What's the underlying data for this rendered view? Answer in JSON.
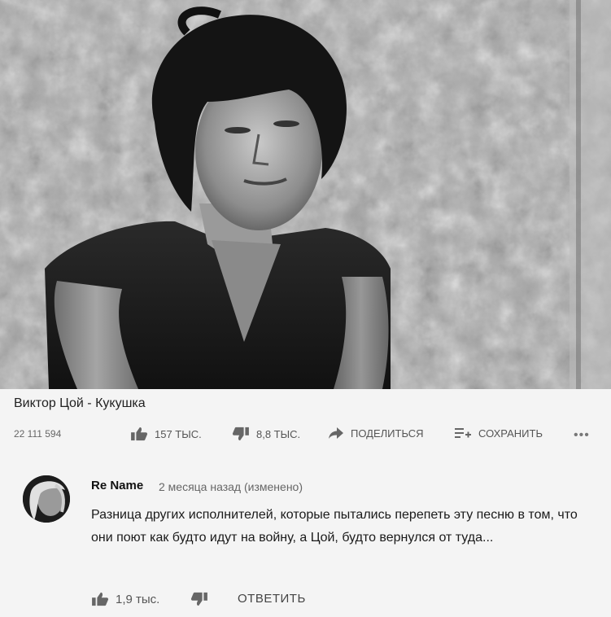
{
  "video": {
    "title": "Виктор Цой - Кукушка",
    "views": "22 111 594",
    "like_count": "157 тыс.",
    "dislike_count": "8,8 тыс.",
    "share_label": "Поделиться",
    "save_label": "Сохранить",
    "more_label": "•••"
  },
  "comment": {
    "author": "Re Name",
    "meta": "2 месяца назад (изменено)",
    "text": "Разница других исполнителей, которые пытались перепеть эту песню в том, что они поют как будто идут на войну, а Цой, будто вернулся от туда...",
    "like_count": "1,9 тыс.",
    "reply_label": "Ответить"
  },
  "icons": {
    "like": "thumbs-up-icon",
    "dislike": "thumbs-down-icon",
    "share": "share-arrow-icon",
    "save": "playlist-add-icon"
  }
}
